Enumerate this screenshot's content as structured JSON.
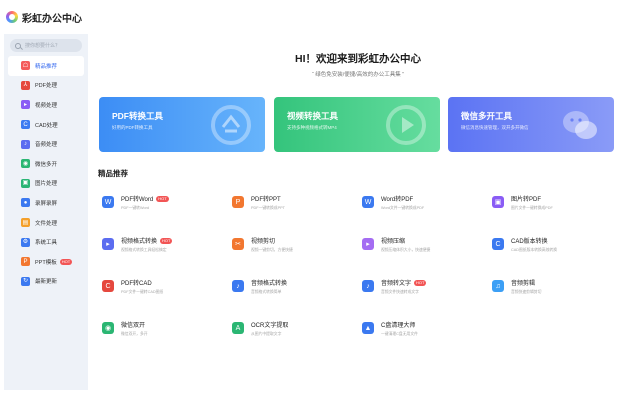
{
  "app": {
    "title": "彩虹办公中心"
  },
  "sidebar": {
    "search_placeholder": "搜你想要什么？",
    "items": [
      {
        "label": "精品推荐",
        "icon": "home-icon",
        "color": "#f45b5b",
        "active": true
      },
      {
        "label": "PDF处理",
        "icon": "pdf-icon",
        "color": "#e5483e"
      },
      {
        "label": "视频处理",
        "icon": "video-icon",
        "color": "#8a5cf5"
      },
      {
        "label": "CAD处理",
        "icon": "cad-icon",
        "color": "#3c7bf1"
      },
      {
        "label": "音频处理",
        "icon": "audio-icon",
        "color": "#5b6cf0"
      },
      {
        "label": "微信多开",
        "icon": "wechat-icon",
        "color": "#2bb673"
      },
      {
        "label": "图片处理",
        "icon": "image-icon",
        "color": "#2ab575"
      },
      {
        "label": "录屏录屏",
        "icon": "record-icon",
        "color": "#3b79f0"
      },
      {
        "label": "文件处理",
        "icon": "file-icon",
        "color": "#f4a02a"
      },
      {
        "label": "系统工具",
        "icon": "system-icon",
        "color": "#3b79f0"
      },
      {
        "label": "PPT模板",
        "icon": "ppt-icon",
        "color": "#f27730",
        "hot": "HOT"
      },
      {
        "label": "最新更新",
        "icon": "update-icon",
        "color": "#3b79f0"
      }
    ]
  },
  "hero": {
    "title": "HI！欢迎来到彩虹办公中心",
    "subtitle": "“ 绿色免安装/便捷/高效的办公工具集 ”"
  },
  "cards": [
    {
      "title": "PDF转换工具",
      "desc": "好用的PDF转换工具",
      "icon": "pdf-convert-icon",
      "color_from": "#3c8df5",
      "color_to": "#67b4fb"
    },
    {
      "title": "视频转换工具",
      "desc": "支持多种视频格式转MP4",
      "icon": "video-convert-icon",
      "color_from": "#34c47c",
      "color_to": "#66dd9f"
    },
    {
      "title": "微信多开工具",
      "desc": "微信消息快速管理，双开多开微信",
      "icon": "wechat-multi-icon",
      "color_from": "#5b73f3",
      "color_to": "#8a9bf7"
    }
  ],
  "section": {
    "title": "精品推荐"
  },
  "tools": [
    {
      "name": "PDF转Word",
      "desc": "PDF一键转Word",
      "icon": "pdf-to-word-icon",
      "color": "#3b79f0",
      "hot": "HOT"
    },
    {
      "name": "PDF转PPT",
      "desc": "PDF一键转换成PPT",
      "icon": "pdf-to-ppt-icon",
      "color": "#f27730"
    },
    {
      "name": "Word转PDF",
      "desc": "Word文件一键转换成PDF",
      "icon": "word-to-pdf-icon",
      "color": "#3b79f0"
    },
    {
      "name": "图片转PDF",
      "desc": "图片文件一键转换成PDF",
      "icon": "image-to-pdf-icon",
      "color": "#8a5cf5"
    },
    {
      "name": "视频格式转换",
      "desc": "视频格式转换工具轻松搞定",
      "icon": "video-format-icon",
      "color": "#5b6cf0",
      "hot": "HOT"
    },
    {
      "name": "视频剪切",
      "desc": "视频一键剪切，方便快捷",
      "icon": "video-cut-icon",
      "color": "#f27730"
    },
    {
      "name": "视频压缩",
      "desc": "视频压缩体积大小，快速便捷",
      "icon": "video-compress-icon",
      "color": "#a46cf2"
    },
    {
      "name": "CAD版本转换",
      "desc": "CAD图纸版本转换高效转换",
      "icon": "cad-version-icon",
      "color": "#3b79f0"
    },
    {
      "name": "PDF转CAD",
      "desc": "PDF文件一键转CAD图纸",
      "icon": "pdf-to-cad-icon",
      "color": "#e5483e"
    },
    {
      "name": "音频格式转换",
      "desc": "音频格式转换简单",
      "icon": "audio-format-icon",
      "color": "#3b79f0"
    },
    {
      "name": "音频转文字",
      "desc": "音频文件快速转成文字",
      "icon": "audio-to-text-icon",
      "color": "#3b79f0",
      "hot": "HOT"
    },
    {
      "name": "音频剪辑",
      "desc": "音频快速剪辑剪切",
      "icon": "audio-edit-icon",
      "color": "#3c9ff5"
    },
    {
      "name": "微信双开",
      "desc": "微信双开，多开",
      "icon": "wechat-dual-icon",
      "color": "#2bb673"
    },
    {
      "name": "OCR文字提取",
      "desc": "从图片中提取文字",
      "icon": "ocr-icon",
      "color": "#2bb673"
    },
    {
      "name": "C盘清理大师",
      "desc": "一键清理C盘无用文件",
      "icon": "disk-clean-icon",
      "color": "#3b79f0"
    }
  ]
}
